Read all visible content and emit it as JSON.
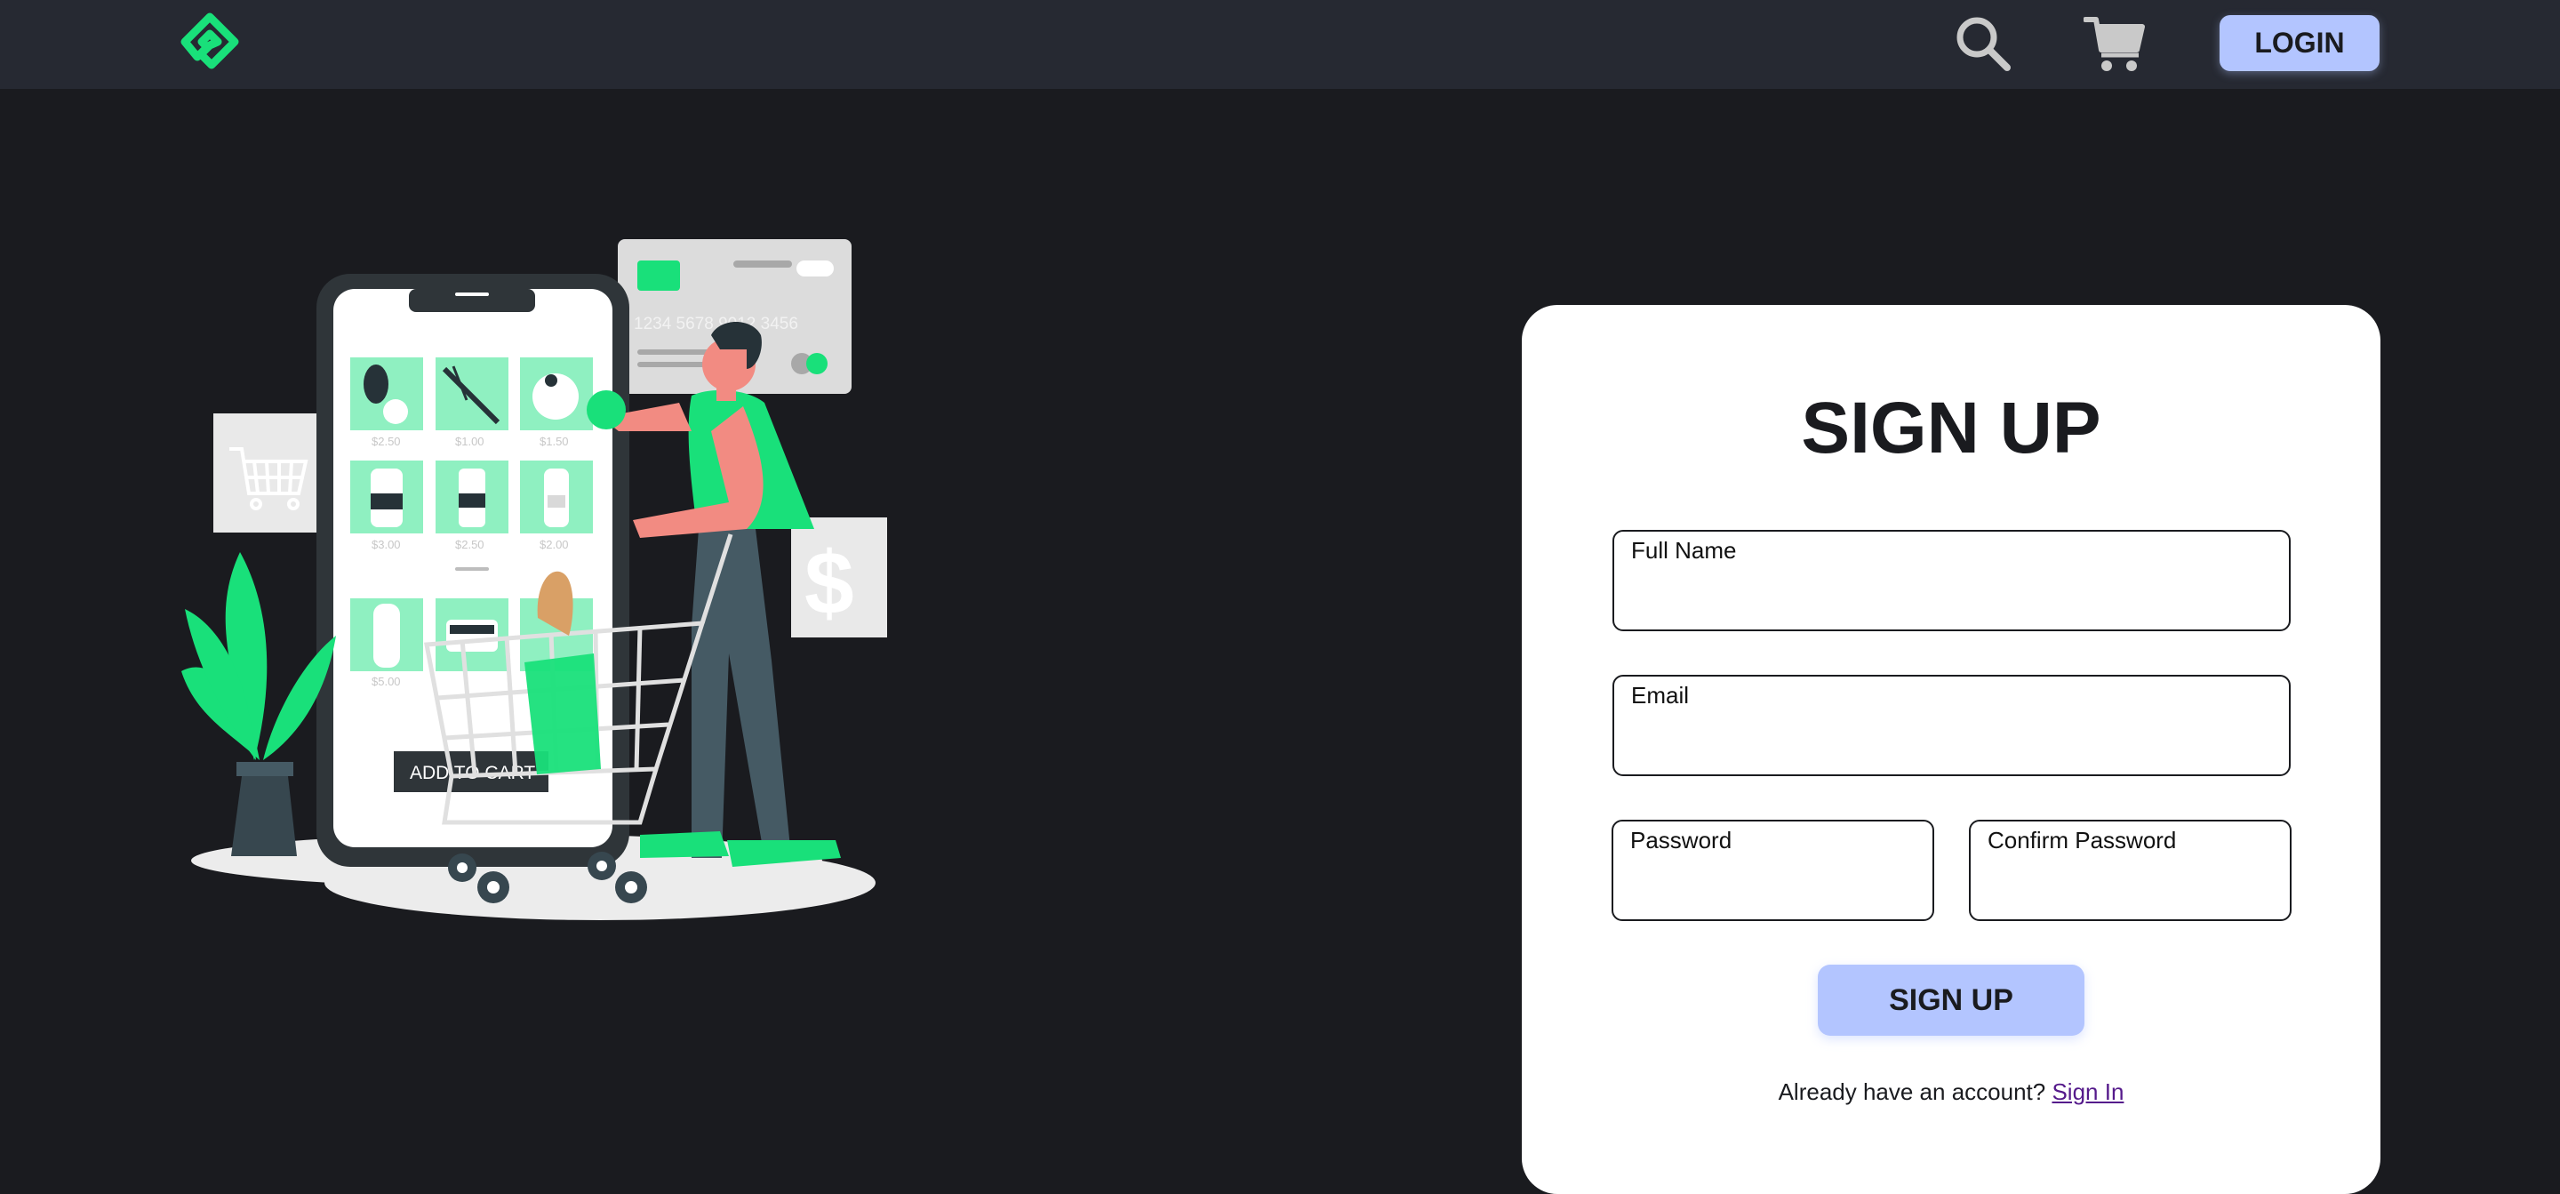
{
  "header": {
    "login_label": "LOGIN",
    "icons": [
      "logo-icon",
      "search-icon",
      "cart-icon"
    ]
  },
  "colors": {
    "page_background": "#1a1b1f",
    "navbar_background": "#262932",
    "brand_green": "#19e07a",
    "button_accent": "#b3c5ff",
    "card_background": "#ffffff"
  },
  "illustration": {
    "prices": [
      "$2.50",
      "$1.00",
      "$1.50",
      "$3.00",
      "$2.50",
      "$2.00",
      "$5.00"
    ],
    "card_number": "1234 5678 9012 3456",
    "add_to_cart": "ADD TO CART",
    "dollar_sign": "$"
  },
  "signup": {
    "title": "SIGN UP",
    "fields": {
      "full_name": {
        "label": "Full Name",
        "value": ""
      },
      "email": {
        "label": "Email",
        "value": ""
      },
      "password": {
        "label": "Password",
        "value": ""
      },
      "confirm_password": {
        "label": "Confirm Password",
        "value": ""
      }
    },
    "submit_label": "SIGN UP",
    "account_prompt": "Already have an account?",
    "signin_link": "Sign In"
  }
}
